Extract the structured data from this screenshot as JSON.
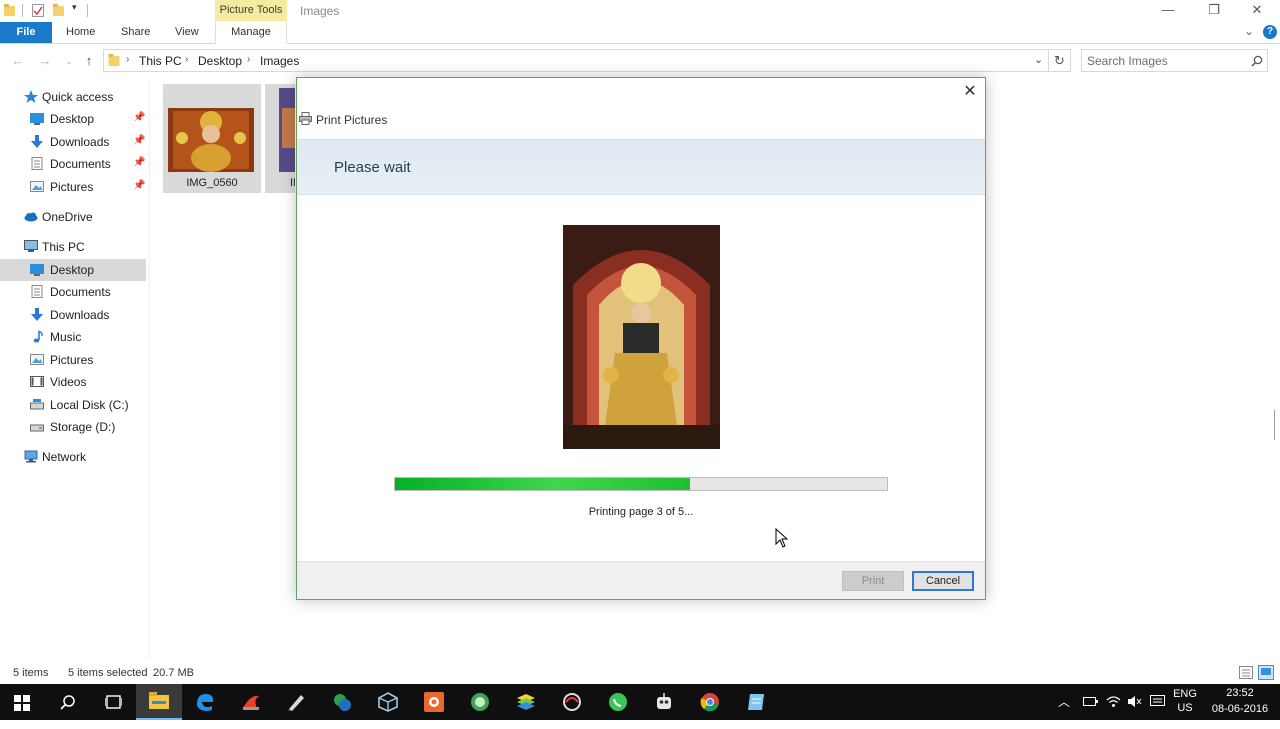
{
  "window": {
    "context_tab": "Picture Tools",
    "title": "Images",
    "controls": {
      "minimize": "—",
      "restore": "❐",
      "close": "✕"
    }
  },
  "ribbon": {
    "tabs": [
      "File",
      "Home",
      "Share",
      "View",
      "Manage"
    ],
    "collapse_glyph": "⌄",
    "help_glyph": "?"
  },
  "address": {
    "breadcrumb": [
      "This PC",
      "Desktop",
      "Images"
    ],
    "search_placeholder": "Search Images"
  },
  "nav": {
    "items": [
      {
        "label": "Quick access",
        "icon": "star-icon",
        "pinned": false
      },
      {
        "label": "Desktop",
        "icon": "desktop-icon",
        "pinned": true
      },
      {
        "label": "Downloads",
        "icon": "download-icon",
        "pinned": true
      },
      {
        "label": "Documents",
        "icon": "documents-icon",
        "pinned": true
      },
      {
        "label": "Pictures",
        "icon": "pictures-icon",
        "pinned": true
      },
      {
        "label": "OneDrive",
        "icon": "cloud-icon",
        "pinned": false
      },
      {
        "label": "This PC",
        "icon": "computer-icon",
        "pinned": false
      },
      {
        "label": "Desktop",
        "icon": "desktop-icon",
        "pinned": false,
        "selected": true
      },
      {
        "label": "Documents",
        "icon": "documents-icon",
        "pinned": false
      },
      {
        "label": "Downloads",
        "icon": "download-icon",
        "pinned": false
      },
      {
        "label": "Music",
        "icon": "music-icon",
        "pinned": false
      },
      {
        "label": "Pictures",
        "icon": "pictures-icon",
        "pinned": false
      },
      {
        "label": "Videos",
        "icon": "videos-icon",
        "pinned": false
      },
      {
        "label": "Local Disk (C:)",
        "icon": "drive-c-icon",
        "pinned": false
      },
      {
        "label": "Storage (D:)",
        "icon": "drive-d-icon",
        "pinned": false
      },
      {
        "label": "Network",
        "icon": "network-icon",
        "pinned": false
      }
    ]
  },
  "files": [
    {
      "name": "IMG_0560"
    },
    {
      "name": "IM"
    }
  ],
  "dialog": {
    "title": "Print Pictures",
    "heading": "Please wait",
    "progress_fraction": 0.6,
    "progress_text": "Printing page 3 of 5...",
    "print_label": "Print",
    "cancel_label": "Cancel",
    "close_glyph": "✕"
  },
  "status": {
    "item_count": "5 items",
    "selection": "5 items selected",
    "size": "20.7 MB"
  },
  "taskbar": {
    "apps": [
      "start-icon",
      "search-icon",
      "task-view-icon",
      "file-explorer-icon",
      "edge-icon",
      "app-red-icon",
      "pen-icon",
      "app-green-icon",
      "cube-icon",
      "app-orange-icon",
      "android-icon",
      "bluestacks-icon",
      "recycle-icon",
      "whatsapp-icon",
      "robot-icon",
      "chrome-icon",
      "notepad-icon"
    ],
    "lang_top": "ENG",
    "lang_bottom": "US",
    "time": "23:52",
    "date": "08-06-2016"
  },
  "colors": {
    "file_tab": "#1979ca",
    "context_tab": "#f5eba0",
    "progress": "#06b025",
    "dialog_border": "#5fa45f",
    "cancel_focus": "#2b78d8"
  }
}
